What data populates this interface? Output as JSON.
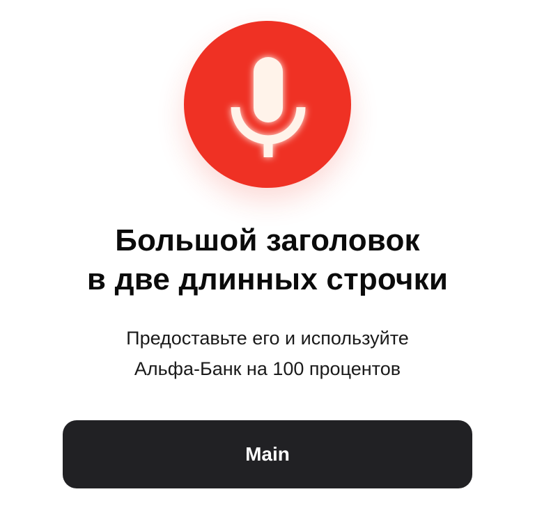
{
  "icon": {
    "name": "microphone-icon",
    "background_color": "#ef3124",
    "glyph_color": "#fff3ea"
  },
  "title": {
    "line1": "Большой заголовок",
    "line2": "в две длинных строчки"
  },
  "subtitle": {
    "line1": "Предоставьте его и используйте",
    "line2": "Альфа-Банк на 100 процентов"
  },
  "button": {
    "label": "Main",
    "background_color": "#212124",
    "text_color": "#ffffff"
  }
}
